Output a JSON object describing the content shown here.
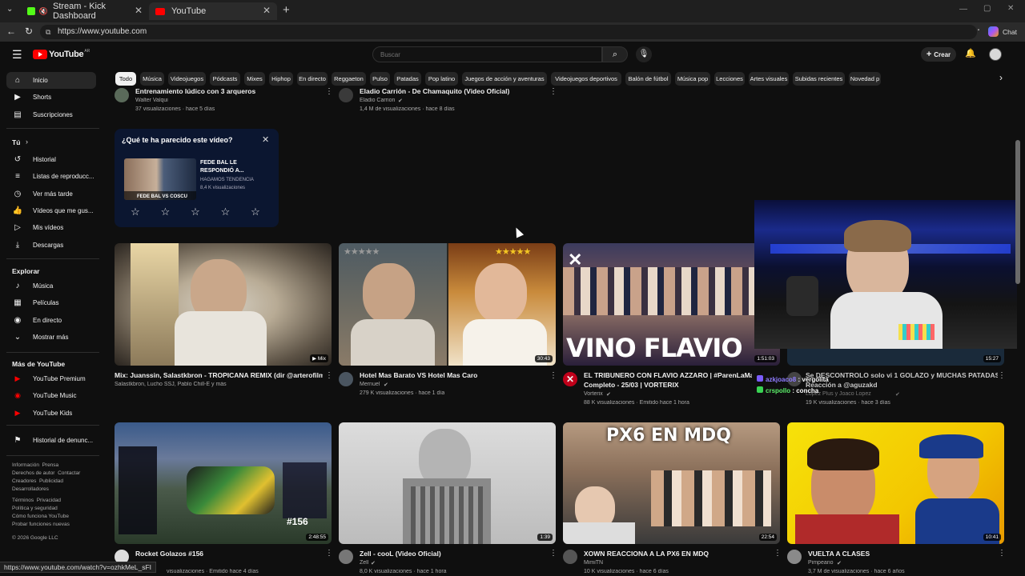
{
  "browser": {
    "tabs": [
      {
        "title": "Stream - Kick Dashboard"
      },
      {
        "title": "YouTube"
      }
    ],
    "url": "https://www.youtube.com",
    "chat_label": "Chat",
    "status_url": "https://www.youtube.com/watch?v=ozhkMeL_sFI"
  },
  "header": {
    "logo_text": "YouTube",
    "region": "AR",
    "search_placeholder": "Buscar",
    "create_label": "Crear"
  },
  "chips": [
    "Todo",
    "Música",
    "Videojuegos",
    "Pódcasts",
    "Mixes",
    "Hiphop",
    "En directo",
    "Reggaeton",
    "Pulso",
    "Patadas",
    "Pop latino",
    "Juegos de acción y aventuras",
    "Videojuegos deportivos",
    "Balón de fútbol",
    "Música pop",
    "Lecciones",
    "Artes visuales",
    "Subidas recientes",
    "Novedad p"
  ],
  "sidebar": {
    "main": [
      {
        "label": "Inicio",
        "icon": "home-icon"
      },
      {
        "label": "Shorts",
        "icon": "shorts-icon"
      },
      {
        "label": "Suscripciones",
        "icon": "subscriptions-icon"
      }
    ],
    "you_head": "Tú",
    "you": [
      {
        "label": "Historial",
        "icon": "history-icon"
      },
      {
        "label": "Listas de reproducc...",
        "icon": "playlist-icon"
      },
      {
        "label": "Ver más tarde",
        "icon": "clock-icon"
      },
      {
        "label": "Vídeos que me gus...",
        "icon": "like-icon"
      },
      {
        "label": "Mis vídeos",
        "icon": "my-videos-icon"
      },
      {
        "label": "Descargas",
        "icon": "download-icon"
      }
    ],
    "explore_head": "Explorar",
    "explore": [
      {
        "label": "Música",
        "icon": "music-icon"
      },
      {
        "label": "Películas",
        "icon": "film-icon"
      },
      {
        "label": "En directo",
        "icon": "live-icon"
      },
      {
        "label": "Mostrar más",
        "icon": "chevron-down-icon"
      }
    ],
    "more_head": "Más de YouTube",
    "more": [
      {
        "label": "YouTube Premium",
        "icon": "youtube-premium-icon"
      },
      {
        "label": "YouTube Music",
        "icon": "youtube-music-icon"
      },
      {
        "label": "YouTube Kids",
        "icon": "youtube-kids-icon"
      }
    ],
    "report": {
      "label": "Historial de denunc...",
      "icon": "flag-icon"
    },
    "footer1": "Información  Prensa\nDerechos de autor  Contactar\nCreadores  Publicidad\nDesarrolladores",
    "footer2": "Términos  Privacidad\nPolítica y seguridad\nCómo funciona YouTube\nProbar funciones nuevas",
    "copyright": "© 2026 Google LLC"
  },
  "top_row": [
    {
      "title": "Entrenamiento lúdico con 3 arqueros",
      "channel": "Walter Valqui",
      "stats": "37 visualizaciones · hace 5 días"
    },
    {
      "title": "Eladio Carrión - De Chamaquito (Video Oficial)",
      "channel": "Eladio Carrion",
      "stats": "1,4 M de visualizaciones · hace 8 días"
    }
  ],
  "survey": {
    "question": "¿Qué te ha parecido este vídeo?",
    "video_title": "FEDE BAL LE RESPONDIÓ A...",
    "channel": "HAGAMOS TENDENCIA",
    "views": "8,4 K visualizaciones",
    "thumb_caption": "FEDE BAL VS COSCU",
    "stars": 5
  },
  "row2": [
    {
      "title": "Mix: Juanssin, Salastkbron - TROPICANA REMIX (dir @arterofilms)",
      "meta": "Salastkbron, Lucho SSJ, Pablo Chill-E y más",
      "badge": "Mix"
    },
    {
      "title": "Hotel Mas Barato VS Hotel Mas Caro",
      "channel": "Mernuel",
      "stats": "279 K visualizaciones · hace 1 día",
      "duration": "30:43"
    },
    {
      "title": "EL TRIBUNERO CON FLAVIO AZZARO | #ParenLaMano",
      "title2": "Completo - 25/03 | VORTERIX",
      "channel": "Vorterix",
      "stats": "88 K visualizaciones · Emitido hace 1 hora",
      "duration": "1:51:03",
      "overlay_text": "VINO FLAVIO"
    },
    {
      "title": "Se DESCONTROLO solo vi 1 GOLAZO  y MUCHAS PATADAS |",
      "title2": "Reacción a @aguzakd",
      "channel": "Lopez Plus y Joaco Lopez",
      "stats": "19 K visualizaciones · hace 3 días",
      "duration": "15:27"
    }
  ],
  "chat_overlay": [
    {
      "user": "azkjoaco8",
      "text": "vergolita"
    },
    {
      "user": "crspollo",
      "text": "concha"
    }
  ],
  "row3": [
    {
      "title": "Rocket Golazos #156",
      "channel": "",
      "stats": "visualizaciones · Emitido hace 4 días",
      "duration": "2:48:55",
      "thumb_text": "#156"
    },
    {
      "title": "Zell - cooL (Video Oficial)",
      "channel": "Zell",
      "stats": "8,0 K visualizaciones · hace 1 hora",
      "duration": "1:39"
    },
    {
      "title": "XOWN REACCIONA A LA PX6 EN MDQ",
      "channel": "MimiTN",
      "stats": "10 K visualizaciones · hace 6 días",
      "duration": "22:54",
      "thumb_text": "PX6 EN MDQ"
    },
    {
      "title": "VUELTA A CLASES",
      "channel": "Pimpeano",
      "stats": "3,7 M de visualizaciones · hace 6 años",
      "duration": "10:41"
    }
  ]
}
